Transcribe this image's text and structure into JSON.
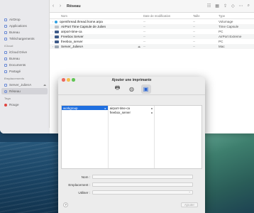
{
  "finder": {
    "title": "Réseau",
    "sidebar": [
      {
        "type": "section",
        "label": ""
      },
      {
        "type": "item",
        "label": "AirDrop",
        "icon": "airdrop-icon"
      },
      {
        "type": "item",
        "label": "Applications",
        "icon": "applications-icon"
      },
      {
        "type": "item",
        "label": "Bureau",
        "icon": "desktop-folder-icon"
      },
      {
        "type": "item",
        "label": "Téléchargements",
        "icon": "downloads-icon"
      },
      {
        "type": "section",
        "label": "iCloud"
      },
      {
        "type": "item",
        "label": "iCloud Drive",
        "icon": "cloud-icon"
      },
      {
        "type": "item",
        "label": "Bureau",
        "icon": "desktop-folder-icon"
      },
      {
        "type": "item",
        "label": "Documents",
        "icon": "documents-icon"
      },
      {
        "type": "item",
        "label": "Partagé",
        "icon": "shared-folder-icon"
      },
      {
        "type": "section",
        "label": "Emplacements"
      },
      {
        "type": "item",
        "label": "Server_JulienA",
        "icon": "server-icon",
        "eject": true
      },
      {
        "type": "item",
        "label": "Réseau",
        "icon": "network-globe-icon",
        "selected": true
      },
      {
        "type": "section",
        "label": "Tags"
      },
      {
        "type": "item",
        "label": "Rouge",
        "icon": "red-tag-icon",
        "tag": true
      }
    ],
    "columns": {
      "name": "Nom",
      "date": "Date de modification",
      "size": "Taille",
      "type": "Type"
    },
    "rows": [
      {
        "name": "openthread.thread.home.arpa",
        "date": "--",
        "size": "--",
        "type": "Volumage",
        "icon": "globe",
        "disclosure": true
      },
      {
        "name": "AirPort Time Capsule de Julien",
        "date": "--",
        "size": "--",
        "type": "Time Capsule",
        "icon": "capsule",
        "disclosure": false
      },
      {
        "name": "airport-time-ca",
        "date": "--",
        "size": "--",
        "type": "PC",
        "icon": "monitor",
        "disclosure": true
      },
      {
        "name": "Freebox Server",
        "date": "--",
        "size": "--",
        "type": "AirPort Extreme",
        "icon": "monitor",
        "disclosure": false
      },
      {
        "name": "freebox_server",
        "date": "--",
        "size": "--",
        "type": "PC",
        "icon": "monitor",
        "disclosure": true
      },
      {
        "name": "Server_JulienA",
        "date": "--",
        "size": "--",
        "type": "Mac",
        "icon": "share",
        "disclosure": true,
        "badge": "⏏"
      }
    ],
    "toolbar": {
      "back": "‹",
      "forward": "›"
    }
  },
  "dialog": {
    "title": "Ajouter une imprimante",
    "toolbar_icons": [
      {
        "name": "default-printer-icon",
        "glyph": "🖶",
        "active": false
      },
      {
        "name": "ip-globe-icon",
        "glyph": "◍",
        "active": false
      },
      {
        "name": "windows-printer-icon",
        "glyph": "▣",
        "active": true
      }
    ],
    "browser": {
      "col1": [
        {
          "label": "workgroup",
          "selected": true,
          "arrow": true
        }
      ],
      "col2": [
        {
          "label": "airport-time-ca",
          "selected": false,
          "arrow": true
        },
        {
          "label": "freebox_server",
          "selected": false,
          "arrow": true
        }
      ]
    },
    "form": {
      "name_label": "Nom :",
      "location_label": "Emplacement :",
      "use_label": "Utiliser :"
    },
    "help_label": "?",
    "add_label": "Ajouter"
  }
}
